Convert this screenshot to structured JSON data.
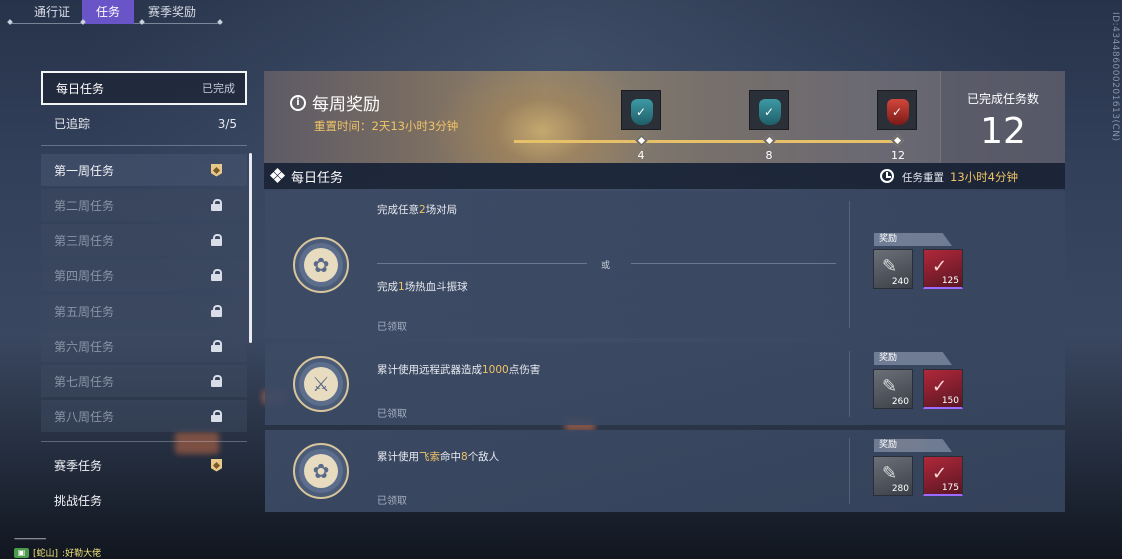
{
  "tabs": [
    {
      "label": "通行证"
    },
    {
      "label": "任务",
      "active": true
    },
    {
      "label": "赛季奖励"
    }
  ],
  "side_id": "ID:434486000201613(CN)",
  "left_menu": {
    "daily": {
      "label": "每日任务",
      "state": "已完成"
    },
    "tracked": {
      "label": "已追踪",
      "count": "3/5"
    },
    "weeks": [
      {
        "label": "第一周任务",
        "status": "unlocked"
      },
      {
        "label": "第二周任务",
        "status": "locked"
      },
      {
        "label": "第三周任务",
        "status": "locked"
      },
      {
        "label": "第四周任务",
        "status": "locked"
      },
      {
        "label": "第五周任务",
        "status": "locked"
      },
      {
        "label": "第六周任务",
        "status": "locked"
      },
      {
        "label": "第七周任务",
        "status": "locked"
      },
      {
        "label": "第八周任务",
        "status": "locked"
      }
    ],
    "season": {
      "label": "赛季任务"
    },
    "challenge": {
      "label": "挑战任务"
    }
  },
  "weekly_reward": {
    "title": "每周奖励",
    "reset_text": "重置时间：2天13小时3分钟",
    "milestones": [
      {
        "value": "4",
        "chest": "teal"
      },
      {
        "value": "8",
        "chest": "teal"
      },
      {
        "value": "12",
        "chest": "red"
      }
    ],
    "completed_label": "已完成任务数",
    "completed_count": "12"
  },
  "daily_header": {
    "title": "每日任务",
    "reset_label": "任务重置",
    "reset_value": "13小时4分钟"
  },
  "tasks": [
    {
      "emblem": "flower-emblem",
      "line1_prefix": "完成任意",
      "line1_num": "2",
      "line1_suffix": "场对局",
      "or": "或",
      "line2_prefix": "完成",
      "line2_num": "1",
      "line2_suffix": "场热血斗振球",
      "claimed": "已领取",
      "reward_label": "奖励",
      "rewards": [
        {
          "qty": "240",
          "type": "grey"
        },
        {
          "qty": "125",
          "type": "red"
        }
      ]
    },
    {
      "emblem": "swords-emblem",
      "line1_prefix": "累计使用远程武器造成",
      "line1_num": "1000",
      "line1_suffix": "点伤害",
      "claimed": "已领取",
      "reward_label": "奖励",
      "rewards": [
        {
          "qty": "260",
          "type": "grey"
        },
        {
          "qty": "150",
          "type": "red"
        }
      ]
    },
    {
      "emblem": "flower-emblem",
      "line1_prefix": "累计使用",
      "line1_hl": "飞索",
      "line1_mid": "命中",
      "line1_num": "8",
      "line1_suffix": "个敌人",
      "claimed": "已领取",
      "reward_label": "奖励",
      "rewards": [
        {
          "qty": "280",
          "type": "grey"
        },
        {
          "qty": "175",
          "type": "red"
        }
      ]
    }
  ],
  "chat": {
    "dashes": "--------------",
    "sender": "[蛇山]",
    "message": ":好勒大佬"
  },
  "colors": {
    "accent": "#6a55c8",
    "gold": "#f0c466",
    "panel": "#3c4a64"
  }
}
